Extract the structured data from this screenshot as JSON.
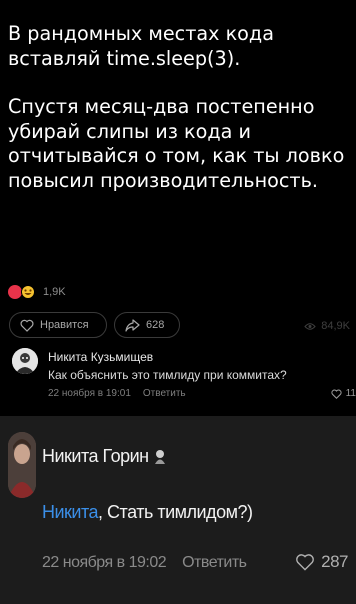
{
  "post": {
    "paragraph1": "В рандомных местах кода вставляй time.sleep(3).",
    "paragraph2": "Спустя месяц-два постепенно убирай слипы из кода и отчитывайся о том, как ты ловко повысил производительность.",
    "reactions": [
      "heart",
      "laughing-face"
    ],
    "reactions_count": "1,9K"
  },
  "actions": {
    "like_label": "Нравится",
    "share_count": "628",
    "views_count": "84,9K"
  },
  "comment1": {
    "author": "Никита Кузьмищев",
    "text": "Как объяснить это тимлиду при коммитах?",
    "date": "22 ноября в 19:01",
    "reply_label": "Ответить",
    "likes": "11"
  },
  "comment2": {
    "author": "Никита Горин",
    "mention": "Никита",
    "text": ", Стать тимлидом?)",
    "date": "22 ноября в 19:02",
    "reply_label": "Ответить",
    "likes": "287"
  },
  "colors": {
    "background": "#000000",
    "comment2_background": "#1c1c1c",
    "mention": "#3b8fe8",
    "heart": "#e8334a"
  }
}
